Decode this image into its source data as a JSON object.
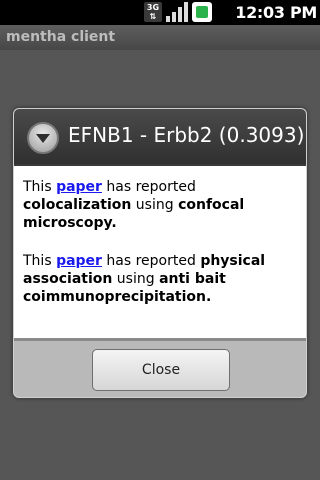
{
  "status_bar": {
    "network_label": "3G",
    "time": "12:03 PM",
    "icons": [
      "network-3g-icon",
      "signal-icon",
      "battery-icon"
    ]
  },
  "app": {
    "title": "mentha client"
  },
  "dialog": {
    "title": "EFNB1 - Erbb2 (0.3093)",
    "icon": "chevron-down-circle-icon",
    "entries": [
      {
        "prefix": "This ",
        "link": "paper",
        "middle": " has reported ",
        "interaction": "colocalization",
        "using_word": " using ",
        "method": "confocal microscopy",
        "suffix": "."
      },
      {
        "prefix": "This ",
        "link": "paper",
        "middle": " has reported ",
        "interaction": "physical association",
        "using_word": " using ",
        "method": "anti bait coimmunoprecipitation",
        "suffix": "."
      }
    ],
    "close_label": "Close"
  },
  "colors": {
    "link": "#1a1aee",
    "dialog_header": "#3a3a3a",
    "status_bar": "#000000",
    "battery": "#2bb24c"
  }
}
